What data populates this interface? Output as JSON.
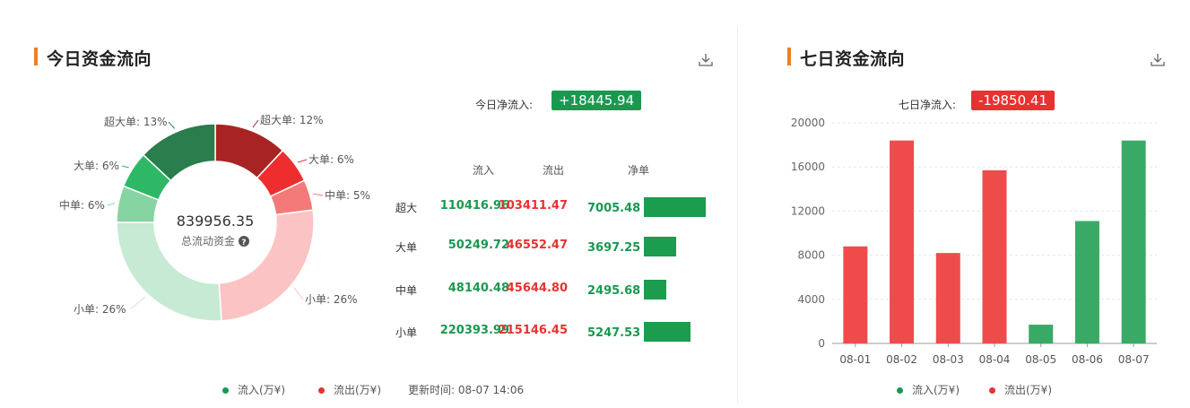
{
  "left": {
    "title": "今日资金流向",
    "net_label": "今日净流入:",
    "net_value": "+18445.94",
    "center_value": "839956.35",
    "center_label": "总流动资金",
    "table": {
      "headers": [
        "流入",
        "流出",
        "净单"
      ],
      "rows": [
        {
          "label": "超大",
          "inflow": "110416.96",
          "outflow": "103411.47",
          "net": "7005.48",
          "net_num": 7005.48
        },
        {
          "label": "大单",
          "inflow": "50249.72",
          "outflow": "46552.47",
          "net": "3697.25",
          "net_num": 3697.25
        },
        {
          "label": "中单",
          "inflow": "48140.48",
          "outflow": "45644.80",
          "net": "2495.68",
          "net_num": 2495.68
        },
        {
          "label": "小单",
          "inflow": "220393.99",
          "outflow": "215146.45",
          "net": "5247.53",
          "net_num": 5247.53
        }
      ]
    },
    "legend": {
      "inflow": "流入(万¥)",
      "outflow": "流出(万¥)",
      "update": "更新时间: 08-07 14:06"
    }
  },
  "right": {
    "title": "七日资金流向",
    "net_label": "七日净流入:",
    "net_value": "-19850.41",
    "legend": {
      "inflow": "流入(万¥)",
      "outflow": "流出(万¥)"
    }
  },
  "colors": {
    "accent": "#f07e1f",
    "green": "#1a9850",
    "red": "#e73232"
  },
  "chart_data": [
    {
      "type": "pie",
      "title": "",
      "slices": [
        {
          "label": "超大单: 12%",
          "value": 12,
          "color": "#a82424"
        },
        {
          "label": "大单: 6%",
          "value": 6,
          "color": "#ee2e2e"
        },
        {
          "label": "中单: 5%",
          "value": 5,
          "color": "#f47a7a"
        },
        {
          "label": "小单: 26%",
          "value": 26,
          "color": "#fbc3c3"
        },
        {
          "label": "小单: 26%",
          "value": 26,
          "color": "#c6ead4"
        },
        {
          "label": "中单: 6%",
          "value": 6,
          "color": "#86d4a1"
        },
        {
          "label": "大单: 6%",
          "value": 6,
          "color": "#2eb866"
        },
        {
          "label": "超大单: 13%",
          "value": 13,
          "color": "#2a7d4c"
        }
      ]
    },
    {
      "type": "bar",
      "title": "",
      "categories": [
        "08-01",
        "08-02",
        "08-03",
        "08-04",
        "08-05",
        "08-06",
        "08-07"
      ],
      "values": [
        8800,
        18400,
        8200,
        15700,
        1700,
        11100,
        18400
      ],
      "colors": [
        "#ef4b4b",
        "#ef4b4b",
        "#ef4b4b",
        "#ef4b4b",
        "#3aa966",
        "#3aa966",
        "#3aa966"
      ],
      "ylim": [
        0,
        20000
      ],
      "yticks": [
        "0",
        "4000",
        "8000",
        "12000",
        "16000",
        "20000"
      ],
      "grid": true
    }
  ]
}
